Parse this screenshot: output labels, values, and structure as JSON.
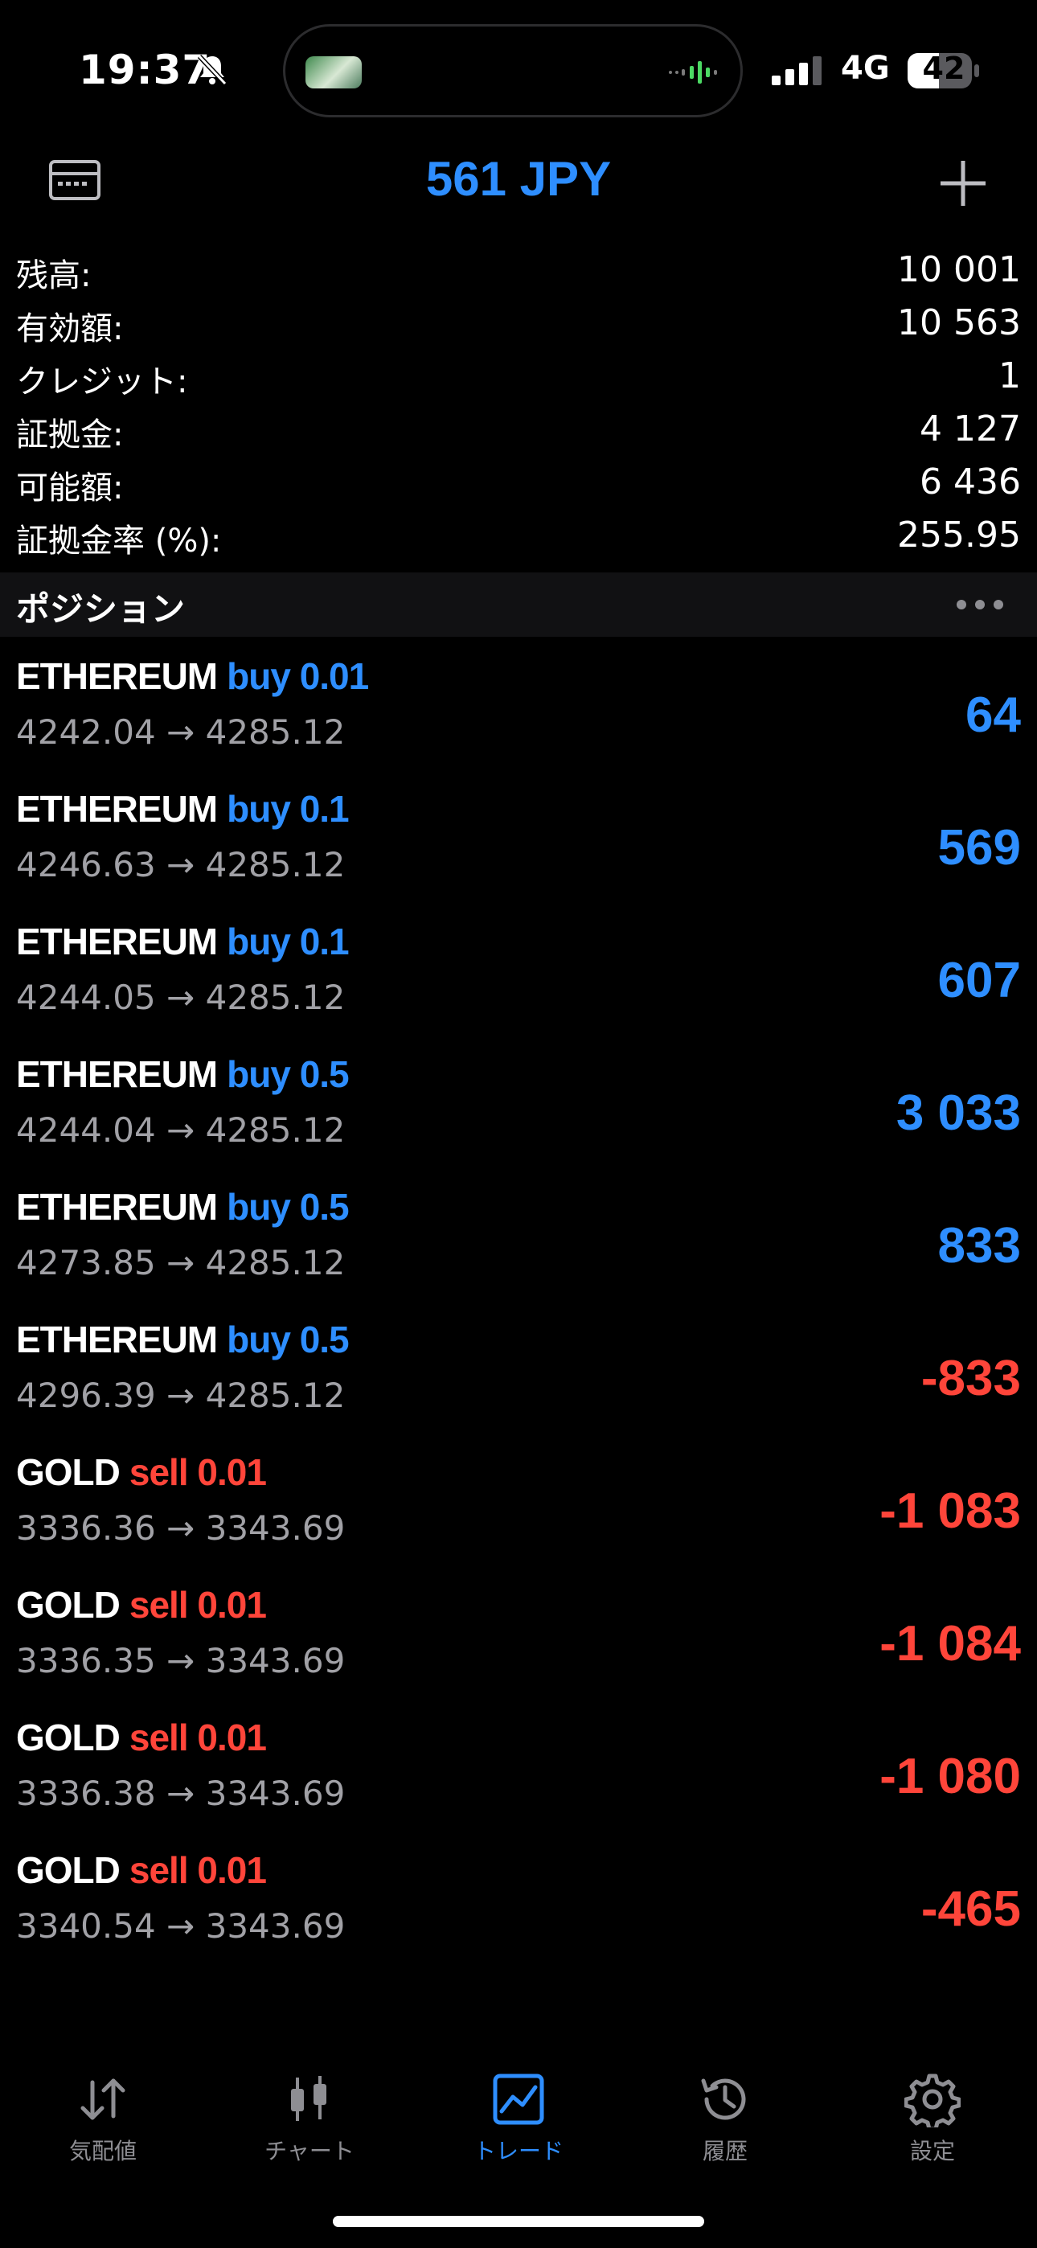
{
  "status_bar": {
    "time": "19:37",
    "network": "4G",
    "battery": "42",
    "icons": [
      "bell-slash-icon",
      "signal-icon",
      "battery-icon"
    ]
  },
  "header": {
    "title": "561 JPY",
    "left_icon": "card-icon",
    "right_icon": "plus-icon",
    "accent_color": "#2e8eff"
  },
  "summary": [
    {
      "label": "残高:",
      "value": "10 001"
    },
    {
      "label": "有効額:",
      "value": "10 563"
    },
    {
      "label": "クレジット:",
      "value": "1"
    },
    {
      "label": "証拠金:",
      "value": "4 127"
    },
    {
      "label": "可能額:",
      "value": "6 436"
    },
    {
      "label": "証拠金率 (%):",
      "value": "255.95"
    }
  ],
  "positions_section": {
    "title": "ポジション",
    "menu_icon": "more-dots-icon"
  },
  "positions": [
    {
      "symbol": "ETHEREUM",
      "side": "buy",
      "volume": "0.01",
      "open": "4242.04",
      "arrow": "→",
      "current": "4285.12",
      "profit": "64",
      "color": "#2e8eff"
    },
    {
      "symbol": "ETHEREUM",
      "side": "buy",
      "volume": "0.1",
      "open": "4246.63",
      "arrow": "→",
      "current": "4285.12",
      "profit": "569",
      "color": "#2e8eff"
    },
    {
      "symbol": "ETHEREUM",
      "side": "buy",
      "volume": "0.1",
      "open": "4244.05",
      "arrow": "→",
      "current": "4285.12",
      "profit": "607",
      "color": "#2e8eff"
    },
    {
      "symbol": "ETHEREUM",
      "side": "buy",
      "volume": "0.5",
      "open": "4244.04",
      "arrow": "→",
      "current": "4285.12",
      "profit": "3 033",
      "color": "#2e8eff"
    },
    {
      "symbol": "ETHEREUM",
      "side": "buy",
      "volume": "0.5",
      "open": "4273.85",
      "arrow": "→",
      "current": "4285.12",
      "profit": "833",
      "color": "#2e8eff"
    },
    {
      "symbol": "ETHEREUM",
      "side": "buy",
      "volume": "0.5",
      "open": "4296.39",
      "arrow": "→",
      "current": "4285.12",
      "profit": "-833",
      "color": "#ff453a"
    },
    {
      "symbol": "GOLD",
      "side": "sell",
      "volume": "0.01",
      "open": "3336.36",
      "arrow": "→",
      "current": "3343.69",
      "profit": "-1 083",
      "color": "#ff453a"
    },
    {
      "symbol": "GOLD",
      "side": "sell",
      "volume": "0.01",
      "open": "3336.35",
      "arrow": "→",
      "current": "3343.69",
      "profit": "-1 084",
      "color": "#ff453a"
    },
    {
      "symbol": "GOLD",
      "side": "sell",
      "volume": "0.01",
      "open": "3336.38",
      "arrow": "→",
      "current": "3343.69",
      "profit": "-1 080",
      "color": "#ff453a"
    },
    {
      "symbol": "GOLD",
      "side": "sell",
      "volume": "0.01",
      "open": "3340.54",
      "arrow": "→",
      "current": "3343.69",
      "profit": "-465",
      "color": "#ff453a"
    }
  ],
  "tabs": [
    {
      "label": "気配値",
      "icon": "quotes-arrows-icon",
      "active": false
    },
    {
      "label": "チャート",
      "icon": "candlestick-icon",
      "active": false
    },
    {
      "label": "トレード",
      "icon": "trade-chart-icon",
      "active": true
    },
    {
      "label": "履歴",
      "icon": "history-clock-icon",
      "active": false
    },
    {
      "label": "設定",
      "icon": "gear-icon",
      "active": false
    }
  ]
}
